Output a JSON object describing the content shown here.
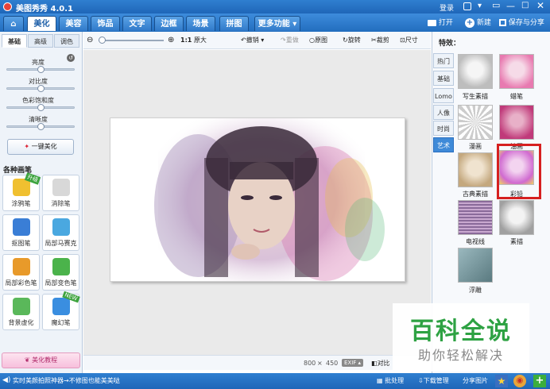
{
  "title": "美图秀秀 4.0.1",
  "title_controls": {
    "login": "登录",
    "icons": [
      "skin-icon",
      "menu-icon",
      "minimize-icon",
      "maximize-icon",
      "close-icon"
    ]
  },
  "tabs": [
    "美化",
    "美容",
    "饰品",
    "文字",
    "边框",
    "场景",
    "拼图",
    "更多功能"
  ],
  "active_tab": "美化",
  "top_right": {
    "open": "打开",
    "new": "新建",
    "save": "保存与分享"
  },
  "left": {
    "subtabs": [
      "基础",
      "高级",
      "调色"
    ],
    "sliders": [
      {
        "label": "亮度",
        "value": 0.5
      },
      {
        "label": "对比度",
        "value": 0.5
      },
      {
        "label": "色彩饱和度",
        "value": 0.5
      },
      {
        "label": "清晰度",
        "value": 0.5
      }
    ],
    "one_click": "一键美化",
    "brushes_title": "各种画笔",
    "brushes": [
      {
        "label": "涂鸦笔",
        "badge": "升级",
        "icon": "pencil-icon",
        "color": "#f0c030"
      },
      {
        "label": "消除笔",
        "badge": "",
        "icon": "eraser-icon",
        "color": "#d8d8d8"
      },
      {
        "label": "抠图笔",
        "badge": "",
        "icon": "cutout-icon",
        "color": "#3a7ed6"
      },
      {
        "label": "局部马赛克",
        "badge": "",
        "icon": "mosaic-icon",
        "color": "#4aa8e0"
      },
      {
        "label": "局部彩色笔",
        "badge": "",
        "icon": "color-brush-icon",
        "color": "#e89a2a"
      },
      {
        "label": "局部变色笔",
        "badge": "",
        "icon": "recolor-brush-icon",
        "color": "#4bb34b"
      },
      {
        "label": "背景虚化",
        "badge": "",
        "icon": "blur-icon",
        "color": "#5ab85a"
      },
      {
        "label": "魔幻笔",
        "badge": "NEW",
        "icon": "magic-wand-icon",
        "color": "#3a8ee0"
      }
    ],
    "tutorial": "美化教程"
  },
  "toolbar": {
    "ratio": "1:1",
    "original_size": "原大",
    "undo": "撤销",
    "redo": "重做",
    "original": "原图",
    "rotate": "旋转",
    "crop": "裁剪",
    "resize": "尺寸"
  },
  "status": {
    "width": "800",
    "times": "×",
    "height": "450",
    "exif": "EXIF",
    "compare": "对比"
  },
  "right": {
    "title": "特效：",
    "categories": [
      "热门",
      "基础",
      "Lomo",
      "人像",
      "时尚",
      "艺术"
    ],
    "active_category": "艺术",
    "effects": [
      {
        "label": "写生素描",
        "color": "#d9d9d9"
      },
      {
        "label": "蜡笔",
        "color": "#e87ab0"
      },
      {
        "label": "漫画",
        "color": "#f2f2f2"
      },
      {
        "label": "油画",
        "color": "#c03a7a"
      },
      {
        "label": "古典素描",
        "color": "#d8c09a"
      },
      {
        "label": "彩铅",
        "color": "#d06ad0"
      },
      {
        "label": "电视线",
        "color": "#8a6a9a"
      },
      {
        "label": "素描",
        "color": "#cfcfcf"
      },
      {
        "label": "浮雕",
        "color": "#7a9aa0"
      }
    ],
    "selected_effect": "彩铅"
  },
  "watermark": {
    "line1": "百科全说",
    "line2": "助你轻松解决"
  },
  "bottom": {
    "tip": "实时美颜拍照神器→不修图也能美美哒",
    "batch": "批处理",
    "download": "下载管理",
    "share": "分享图片"
  }
}
